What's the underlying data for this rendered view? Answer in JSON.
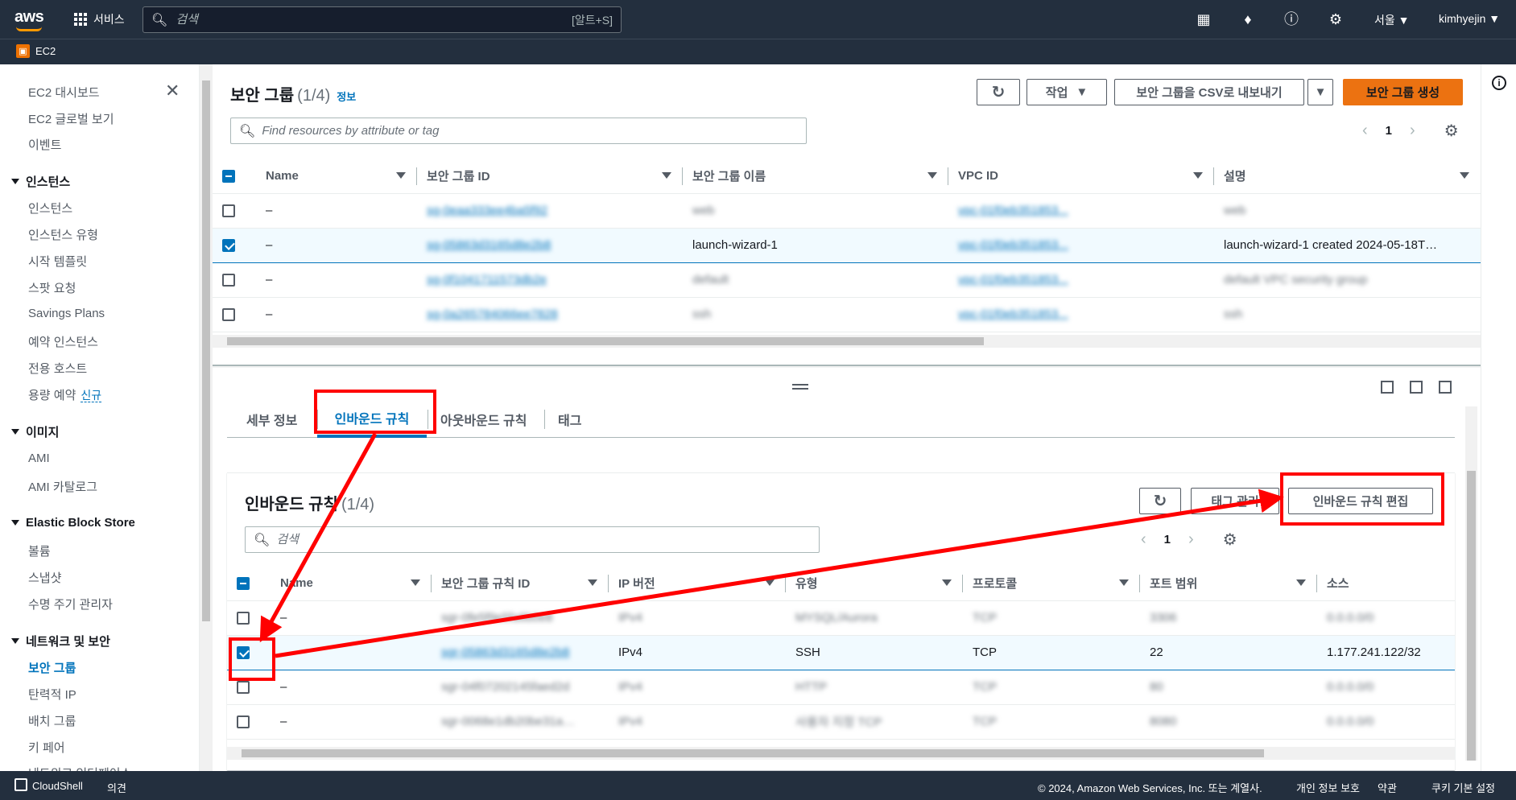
{
  "topbar": {
    "logo": "aws",
    "services_label": "서비스",
    "search_placeholder": "검색",
    "search_shortcut": "[알트+S]",
    "region": "서울 ▼",
    "user": "kimhyejin ▼"
  },
  "service_bar": {
    "name": "EC2"
  },
  "sidebar": {
    "top_items": [
      "EC2 대시보드",
      "EC2 글로벌 보기",
      "이벤트"
    ],
    "groups": [
      {
        "title": "인스턴스",
        "items": [
          "인스턴스",
          "인스턴스 유형",
          "시작 템플릿",
          "스팟 요청",
          "Savings Plans",
          "예약 인스턴스",
          "전용 호스트",
          "용량 예약"
        ]
      },
      {
        "title": "이미지",
        "items": [
          "AMI",
          "AMI 카탈로그"
        ]
      },
      {
        "title": "Elastic Block Store",
        "items": [
          "볼륨",
          "스냅샷",
          "수명 주기 관리자"
        ]
      },
      {
        "title": "네트워크 및 보안",
        "items": [
          "보안 그룹",
          "탄력적 IP",
          "배치 그룹",
          "키 페어",
          "네트워크 인터페이스"
        ]
      }
    ],
    "new_badge": "신규",
    "active_item": "보안 그룹"
  },
  "security_groups": {
    "title": "보안 그룹",
    "count": "(1/4)",
    "info": "정보",
    "actions_label": "작업",
    "export_label": "보안 그룹을 CSV로 내보내기",
    "create_label": "보안 그룹 생성",
    "filter_placeholder": "Find resources by attribute or tag",
    "page": "1",
    "columns": [
      "Name",
      "보안 그룹 ID",
      "보안 그룹 이름",
      "VPC ID",
      "설명"
    ],
    "rows": [
      {
        "name": "–",
        "id": "sg-0eaa333ee4ba5f92",
        "group_name": "web",
        "vpc": "vpc-01f0eb351853...",
        "desc": "web",
        "selected": false
      },
      {
        "name": "–",
        "id": "sg-05863d3165d8e2b8",
        "group_name": "launch-wizard-1",
        "vpc": "vpc-01f0eb351853...",
        "desc": "launch-wizard-1 created 2024-05-18T…",
        "selected": true
      },
      {
        "name": "–",
        "id": "sg-0f1041711573db2e",
        "group_name": "default",
        "vpc": "vpc-01f0eb351853...",
        "desc": "default VPC security group",
        "selected": false
      },
      {
        "name": "–",
        "id": "sg-0a265784066ee7828",
        "group_name": "ssh",
        "vpc": "vpc-01f0eb351853...",
        "desc": "ssh",
        "selected": false
      }
    ]
  },
  "details": {
    "tabs": [
      "세부 정보",
      "인바운드 규칙",
      "아웃바운드 규칙",
      "태그"
    ],
    "active_tab": "인바운드 규칙",
    "inbound": {
      "title": "인바운드 규칙",
      "count": "(1/4)",
      "manage_tags_label": "태그 관리",
      "edit_label": "인바운드 규칙 편집",
      "search_placeholder": "검색",
      "page": "1",
      "columns": [
        "Name",
        "보안 그룹 규칙 ID",
        "IP 버전",
        "유형",
        "프로토콜",
        "포트 범위",
        "소스"
      ],
      "rows": [
        {
          "name": "–",
          "rule_id": "sgr-0fe5f9e5fa6b0e8",
          "ip": "IPv4",
          "type": "MYSQL/Aurora",
          "proto": "TCP",
          "port": "3306",
          "source": "0.0.0.0/0",
          "selected": false
        },
        {
          "name": "",
          "rule_id": "sgr-05863d3165d8e2b8",
          "ip": "IPv4",
          "type": "SSH",
          "proto": "TCP",
          "port": "22",
          "source": "1.177.241.122/32",
          "selected": true
        },
        {
          "name": "–",
          "rule_id": "sgr-04f07202145faed2d",
          "ip": "IPv4",
          "type": "HTTP",
          "proto": "TCP",
          "port": "80",
          "source": "0.0.0.0/0",
          "selected": false
        },
        {
          "name": "–",
          "rule_id": "sgr-0068e1db20be31a…",
          "ip": "IPv4",
          "type": "사용자 지정 TCP",
          "proto": "TCP",
          "port": "8080",
          "source": "0.0.0.0/0",
          "selected": false
        }
      ]
    }
  },
  "footer": {
    "cloudshell": "CloudShell",
    "feedback": "의견",
    "copyright": "© 2024, Amazon Web Services, Inc. 또는 계열사.",
    "privacy": "개인 정보 보호",
    "terms": "약관",
    "cookies": "쿠키 기본 설정"
  },
  "colors": {
    "topbar": "#232f3e",
    "accent": "#ec7211",
    "link": "#0073bb",
    "annotation": "#ff0000"
  }
}
